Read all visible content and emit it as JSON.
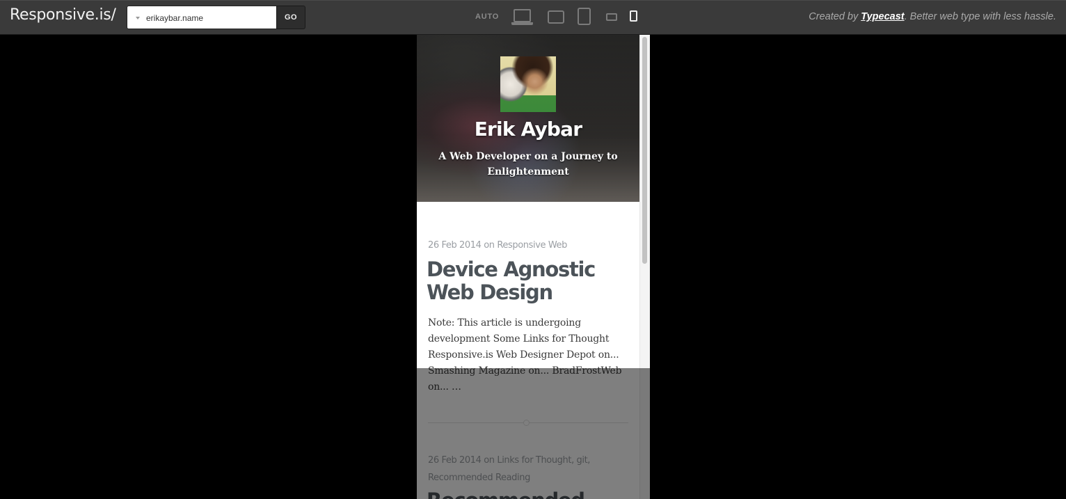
{
  "toolbar": {
    "brand": "Responsive.is/",
    "url_value": "erikaybar.name",
    "go_label": "GO",
    "auto_label": "AUTO",
    "devices": [
      "laptop-icon",
      "tablet-landscape-icon",
      "tablet-portrait-icon",
      "phone-landscape-icon",
      "phone-portrait-icon"
    ],
    "active_device": "phone-portrait-icon",
    "credit_prefix": "Created by ",
    "credit_link": "Typecast",
    "credit_suffix": ". Better web type with less hassle."
  },
  "site": {
    "name": "Erik Aybar",
    "tagline": "A Web Developer on a Journey to Enlightenment"
  },
  "posts": [
    {
      "date": "26 Feb 2014",
      "on": " on ",
      "tags": "Responsive Web",
      "title": "Device Agnostic Web Design",
      "excerpt": "Note: This article is undergoing development Some Links for Thought Responsive.is Web Designer Depot on... Smashing Magazine on... BradFrostWeb on... …"
    },
    {
      "date": "26 Feb 2014",
      "on": " on ",
      "tags": "Links for Thought, git, Recommended Reading",
      "title": "Recommended"
    }
  ],
  "colors": {
    "toolbar_bg": "#3a3a3a",
    "title_text": "#4c5359",
    "meta_text": "#9a9ea3"
  }
}
